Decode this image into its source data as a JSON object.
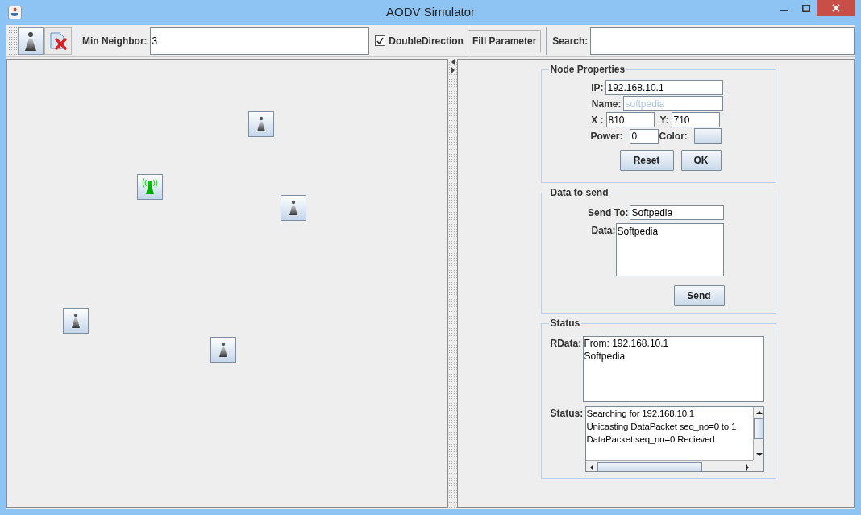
{
  "window": {
    "title": "AODV Simulator"
  },
  "toolbar": {
    "min_neighbor": {
      "label": "Min Neighbor:",
      "value": "3"
    },
    "double_direction": {
      "label": "DoubleDirection",
      "checked": true
    },
    "fill_button": "Fill Parameter",
    "search": {
      "label": "Search:"
    }
  },
  "canvas": {
    "nodes": [
      {
        "active": false
      },
      {
        "active": true
      },
      {
        "active": false
      },
      {
        "active": false
      },
      {
        "active": false
      }
    ]
  },
  "node_properties": {
    "title": "Node Properties",
    "ip": {
      "label": "IP:",
      "value": "192.168.10.1"
    },
    "name": {
      "label": "Name:",
      "value": "softpedia",
      "disabled": true
    },
    "x": {
      "label": "X :",
      "value": "810"
    },
    "y": {
      "label": "Y:",
      "value": "710"
    },
    "power": {
      "label": "Power:",
      "value": "0"
    },
    "color": {
      "label": "Color:"
    },
    "buttons": [
      "Reset",
      "OK"
    ]
  },
  "data_to_send": {
    "title": "Data to send",
    "send_to": {
      "label": "Send To:",
      "value": "Softpedia"
    },
    "data": {
      "label": "Data:",
      "value": "Softpedia"
    },
    "send_button": "Send"
  },
  "status": {
    "title": "Status",
    "rdata": {
      "label": "RData:",
      "lines": [
        "From: 192.168.10.1",
        "Softpedia"
      ]
    },
    "status": {
      "label": "Status:",
      "lines": [
        "Searching for 192.168.10.1",
        "Unicasting DataPacket seq_no=0 to 1",
        "DataPacket seq_no=0 Recieved"
      ]
    }
  }
}
